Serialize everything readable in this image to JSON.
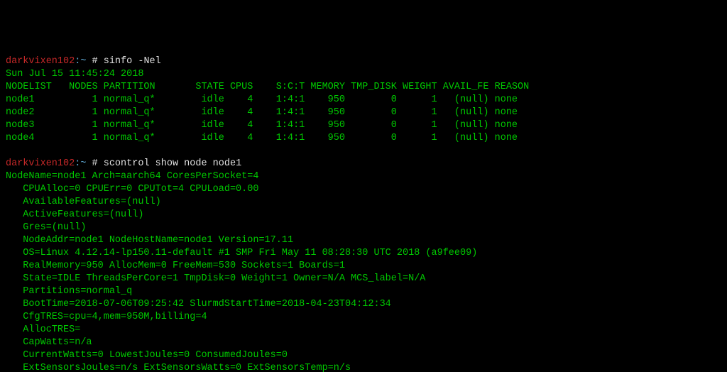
{
  "p1": {
    "host": "darkvixen102",
    "path": ":~ ",
    "hash": "# ",
    "cmd": "sinfo -Nel"
  },
  "date": "Sun Jul 15 11:45:24 2018",
  "hdr": "NODELIST   NODES PARTITION       STATE CPUS    S:C:T MEMORY TMP_DISK WEIGHT AVAIL_FE REASON",
  "rows": [
    "node1          1 normal_q*        idle    4    1:4:1    950        0      1   (null) none",
    "node2          1 normal_q*        idle    4    1:4:1    950        0      1   (null) none",
    "node3          1 normal_q*        idle    4    1:4:1    950        0      1   (null) none",
    "node4          1 normal_q*        idle    4    1:4:1    950        0      1   (null) none"
  ],
  "blank": " ",
  "p2": {
    "host": "darkvixen102",
    "path": ":~ ",
    "hash": "# ",
    "cmd": "scontrol show node node1"
  },
  "info": [
    "NodeName=node1 Arch=aarch64 CoresPerSocket=4",
    "   CPUAlloc=0 CPUErr=0 CPUTot=4 CPULoad=0.00",
    "   AvailableFeatures=(null)",
    "   ActiveFeatures=(null)",
    "   Gres=(null)",
    "   NodeAddr=node1 NodeHostName=node1 Version=17.11",
    "   OS=Linux 4.12.14-lp150.11-default #1 SMP Fri May 11 08:28:30 UTC 2018 (a9fee09)",
    "   RealMemory=950 AllocMem=0 FreeMem=530 Sockets=1 Boards=1",
    "   State=IDLE ThreadsPerCore=1 TmpDisk=0 Weight=1 Owner=N/A MCS_label=N/A",
    "   Partitions=normal_q",
    "   BootTime=2018-07-06T09:25:42 SlurmdStartTime=2018-04-23T04:12:34",
    "   CfgTRES=cpu=4,mem=950M,billing=4",
    "   AllocTRES=",
    "   CapWatts=n/a",
    "   CurrentWatts=0 LowestJoules=0 ConsumedJoules=0",
    "   ExtSensorsJoules=n/s ExtSensorsWatts=0 ExtSensorsTemp=n/s"
  ]
}
